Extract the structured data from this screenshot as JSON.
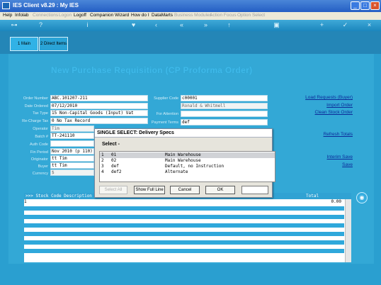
{
  "window": {
    "title": "IES Client v8.29 : My IES"
  },
  "menu": [
    {
      "label": "Help",
      "enabled": true
    },
    {
      "label": "Infolab",
      "enabled": true
    },
    {
      "label": "Connections",
      "enabled": false
    },
    {
      "label": "Logon",
      "enabled": false
    },
    {
      "label": "Logoff",
      "enabled": true
    },
    {
      "label": "Companion",
      "enabled": true
    },
    {
      "label": "Wizard",
      "enabled": true
    },
    {
      "label": "How do I",
      "enabled": true
    },
    {
      "label": "DataMarts",
      "enabled": true
    },
    {
      "label": "Business Modules",
      "enabled": false
    },
    {
      "label": "Action Focus",
      "enabled": false
    },
    {
      "label": "Option Select",
      "enabled": false
    }
  ],
  "toolbar_icons": [
    "key-icon",
    "help-icon",
    "info-icon",
    "home-icon",
    "back-icon",
    "rewind-icon",
    "forward-icon",
    "up-icon",
    "lock-icon",
    "add-icon",
    "check-icon",
    "close-icon"
  ],
  "tabs": {
    "main": "1 Main",
    "direct": "2 Direct Items"
  },
  "heading": "New Purchase Requisition (CP Proforma Order)",
  "form_left": {
    "labels": [
      "Order Number",
      "Date Ordered",
      "Tax Type",
      "Re-Charge Tax",
      "Operator",
      "Batch #",
      "Auth Code",
      "Fin Period",
      "Originator",
      "Buyer",
      "Currency"
    ],
    "values": [
      "ABC.101207-211",
      "07/12/2010",
      "15 Non-Capital Goods (Input) Vat",
      "0 No Tax Record",
      "Tim",
      "TT-241110",
      "",
      "Nov 2010 (p 110)",
      "tt Tim",
      "tt Tim",
      "$"
    ]
  },
  "form_right": {
    "labels": [
      "Supplier Code",
      "",
      "For Attention",
      "Payment Terms"
    ],
    "values": [
      "c00001",
      "Ronald & Whitmell",
      "",
      "def"
    ]
  },
  "links": {
    "load_requests": "Load Requests (Buyer)",
    "import_order": "Import Order",
    "clean_stock": "Clean Stock Order",
    "refresh_totals": "Refresh Totals",
    "interim_save": "Interim Save",
    "save": "Save"
  },
  "dialog": {
    "title": "SINGLE SELECT: Delivery Specs",
    "prompt": "Select -",
    "rows": [
      {
        "n": "1",
        "code": "01",
        "desc": "Main Warehouse",
        "selected": true
      },
      {
        "n": "2",
        "code": "02",
        "desc": "Main Warehouse",
        "selected": false
      },
      {
        "n": "3",
        "code": "def",
        "desc": "Default, no Instruction",
        "selected": false
      },
      {
        "n": "4",
        "code": "def2",
        "desc": "Alternate",
        "selected": false
      }
    ],
    "buttons": {
      "select_all": "Select All",
      "show_full": "Show Full Line",
      "cancel": "Cancel",
      "ok": "OK"
    },
    "filter_value": ""
  },
  "grid": {
    "header": ">>> Stock Code Description",
    "header_right": "Total",
    "first_row_num": "1",
    "first_row_total": "0.00"
  }
}
